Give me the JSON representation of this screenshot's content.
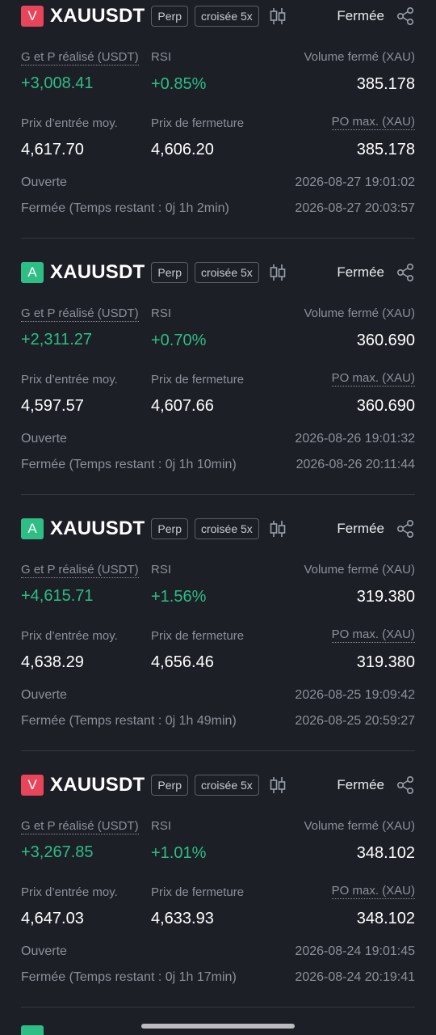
{
  "trades": [
    {
      "side": "V",
      "side_type": "sell",
      "symbol": "XAUUSDT",
      "perp": "Perp",
      "margin": "croisée 5x",
      "status": "Fermée",
      "pnl_label": "G et P réalisé (USDT)",
      "pnl": "+3,008.41",
      "rsi_label": "RSI",
      "rsi": "+0.85%",
      "vol_label": "Volume fermé (XAU)",
      "vol": "385.178",
      "entry_label": "Prix d’entrée moy.",
      "entry": "4,617.70",
      "close_label": "Prix de fermeture",
      "close": "4,606.20",
      "po_label": "PO max. (XAU)",
      "po": "385.178",
      "open_label": "Ouverte",
      "open_time": "2026-08-27 19:01:02",
      "closed_label": "Fermée (Temps restant : 0j 1h 2min)",
      "closed_time": "2026-08-27 20:03:57"
    },
    {
      "side": "A",
      "side_type": "buy",
      "symbol": "XAUUSDT",
      "perp": "Perp",
      "margin": "croisée 5x",
      "status": "Fermée",
      "pnl_label": "G et P réalisé (USDT)",
      "pnl": "+2,311.27",
      "rsi_label": "RSI",
      "rsi": "+0.70%",
      "vol_label": "Volume fermé (XAU)",
      "vol": "360.690",
      "entry_label": "Prix d’entrée moy.",
      "entry": "4,597.57",
      "close_label": "Prix de fermeture",
      "close": "4,607.66",
      "po_label": "PO max. (XAU)",
      "po": "360.690",
      "open_label": "Ouverte",
      "open_time": "2026-08-26 19:01:32",
      "closed_label": "Fermée (Temps restant : 0j 1h 10min)",
      "closed_time": "2026-08-26 20:11:44"
    },
    {
      "side": "A",
      "side_type": "buy",
      "symbol": "XAUUSDT",
      "perp": "Perp",
      "margin": "croisée 5x",
      "status": "Fermée",
      "pnl_label": "G et P réalisé (USDT)",
      "pnl": "+4,615.71",
      "rsi_label": "RSI",
      "rsi": "+1.56%",
      "vol_label": "Volume fermé (XAU)",
      "vol": "319.380",
      "entry_label": "Prix d’entrée moy.",
      "entry": "4,638.29",
      "close_label": "Prix de fermeture",
      "close": "4,656.46",
      "po_label": "PO max. (XAU)",
      "po": "319.380",
      "open_label": "Ouverte",
      "open_time": "2026-08-25 19:09:42",
      "closed_label": "Fermée (Temps restant : 0j 1h 49min)",
      "closed_time": "2026-08-25 20:59:27"
    },
    {
      "side": "V",
      "side_type": "sell",
      "symbol": "XAUUSDT",
      "perp": "Perp",
      "margin": "croisée 5x",
      "status": "Fermée",
      "pnl_label": "G et P réalisé (USDT)",
      "pnl": "+3,267.85",
      "rsi_label": "RSI",
      "rsi": "+1.01%",
      "vol_label": "Volume fermé (XAU)",
      "vol": "348.102",
      "entry_label": "Prix d’entrée moy.",
      "entry": "4,647.03",
      "close_label": "Prix de fermeture",
      "close": "4,633.93",
      "po_label": "PO max. (XAU)",
      "po": "348.102",
      "open_label": "Ouverte",
      "open_time": "2026-08-24 19:01:45",
      "closed_label": "Fermée (Temps restant : 0j 1h 17min)",
      "closed_time": "2026-08-24 20:19:41"
    }
  ],
  "colors": {
    "buy": "#2ebd85",
    "sell": "#e8445a",
    "background": "#1c1f26"
  },
  "icons": {
    "chart": "candlestick-icon",
    "share": "share-icon"
  }
}
